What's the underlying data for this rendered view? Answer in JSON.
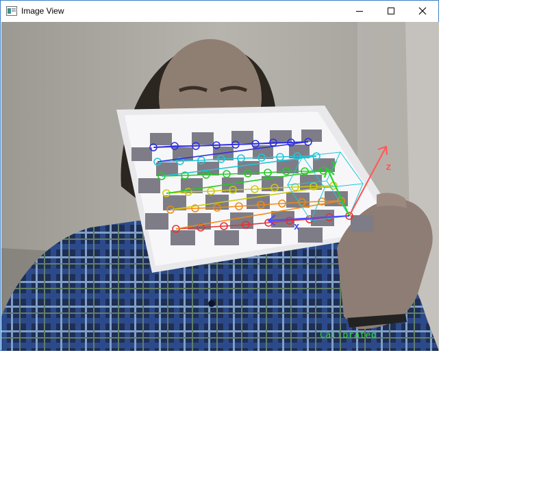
{
  "window": {
    "title": "Image View",
    "icon": "image-view-app-icon",
    "controls": [
      "minimize-icon",
      "maximize-icon",
      "close-icon"
    ]
  },
  "overlay": {
    "status_text": "Calibrated",
    "axis_x_label": "x",
    "axis_y_label": "y",
    "axis_z_label": "z",
    "colors": {
      "status": "#2ee22e",
      "axis_x": "#4c4cff",
      "axis_y": "#22d422",
      "axis_z": "#ff5a5a",
      "cube": "#17c9d9"
    }
  }
}
